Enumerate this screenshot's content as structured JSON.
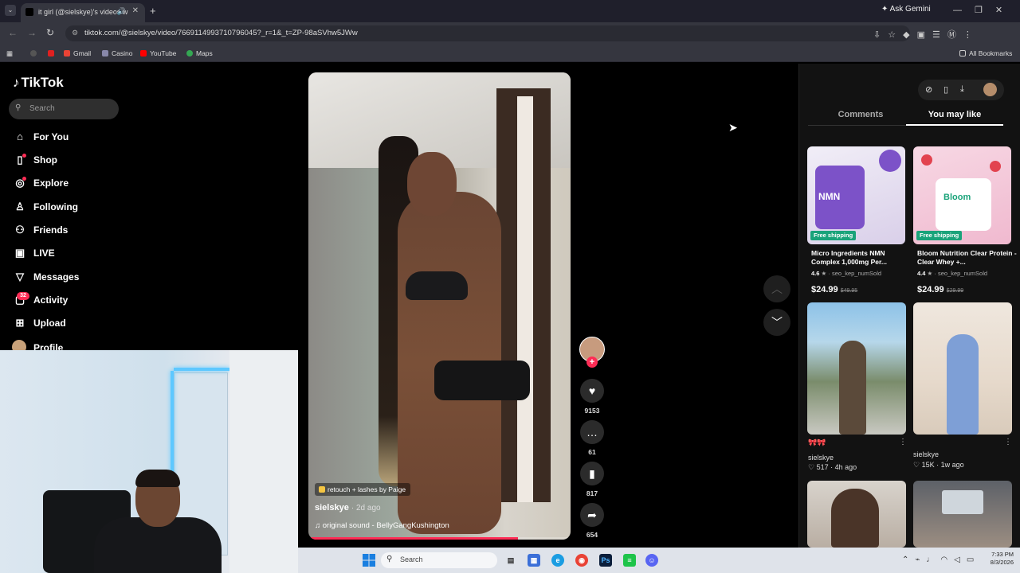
{
  "browser": {
    "tab_title": "it girl (@sielskye)'s videos w",
    "url": "tiktok.com/@sielskye/video/7669114993710796045?_r=1&_t=ZP-98aSVhw5JWw",
    "gemini_label": "Ask Gemini",
    "bookmarks": [
      {
        "label": "",
        "color": "#444"
      },
      {
        "label": "",
        "color": "#e02020"
      },
      {
        "label": "Gmail",
        "color": "#ea4335"
      },
      {
        "label": "Casino",
        "color": "#8888aa"
      },
      {
        "label": "YouTube",
        "color": "#ff0000"
      },
      {
        "label": "Maps",
        "color": "#34a853"
      }
    ],
    "all_bookmarks": "All Bookmarks"
  },
  "sidebar": {
    "logo": "TikTok",
    "search_placeholder": "Search",
    "items": [
      {
        "label": "For You",
        "icon": "home-icon"
      },
      {
        "label": "Shop",
        "icon": "bag-icon"
      },
      {
        "label": "Explore",
        "icon": "compass-icon"
      },
      {
        "label": "Following",
        "icon": "following-icon"
      },
      {
        "label": "Friends",
        "icon": "friends-icon"
      },
      {
        "label": "LIVE",
        "icon": "live-icon"
      },
      {
        "label": "Messages",
        "icon": "paper-plane-icon"
      },
      {
        "label": "Activity",
        "icon": "activity-icon"
      },
      {
        "label": "Upload",
        "icon": "plus-square-icon"
      },
      {
        "label": "Profile",
        "icon": "avatar"
      }
    ],
    "activity_badge": "32"
  },
  "video": {
    "caption_tag": "retouch + lashes by Paige",
    "username": "sielskye",
    "posted_ago": "· 2d ago",
    "sound": "original sound - BellyGangKushington",
    "progress": 0.8
  },
  "actions": {
    "likes": "9153",
    "comments": "61",
    "saves": "817",
    "shares": "654"
  },
  "right_panel": {
    "tabs": [
      "Comments",
      "You may like"
    ],
    "active_tab": "You may like",
    "products": [
      {
        "title": "Micro Ingredients NMN Complex 1,000mg Per...",
        "rating": "4.6",
        "sold": "seo_kep_numSold",
        "price": "$24.99",
        "original_price": "$49.95",
        "badge": "Free shipping",
        "img_text": "NMN"
      },
      {
        "title": "Bloom Nutrition Clear Protein - Clear Whey +...",
        "rating": "4.4",
        "sold": "seo_kep_numSold",
        "price": "$24.99",
        "original_price": "$29.99",
        "badge": "Free shipping",
        "img_text": "Bloom"
      }
    ],
    "videos": [
      {
        "user": "sielskye",
        "caption": "🎀🎀",
        "likes": "517",
        "ago": "4h ago"
      },
      {
        "user": "sielskye",
        "caption": "",
        "likes": "15K",
        "ago": "1w ago"
      }
    ]
  },
  "taskbar": {
    "search_placeholder": "Search",
    "time": "7:33 PM",
    "date": "8/3/2026"
  }
}
